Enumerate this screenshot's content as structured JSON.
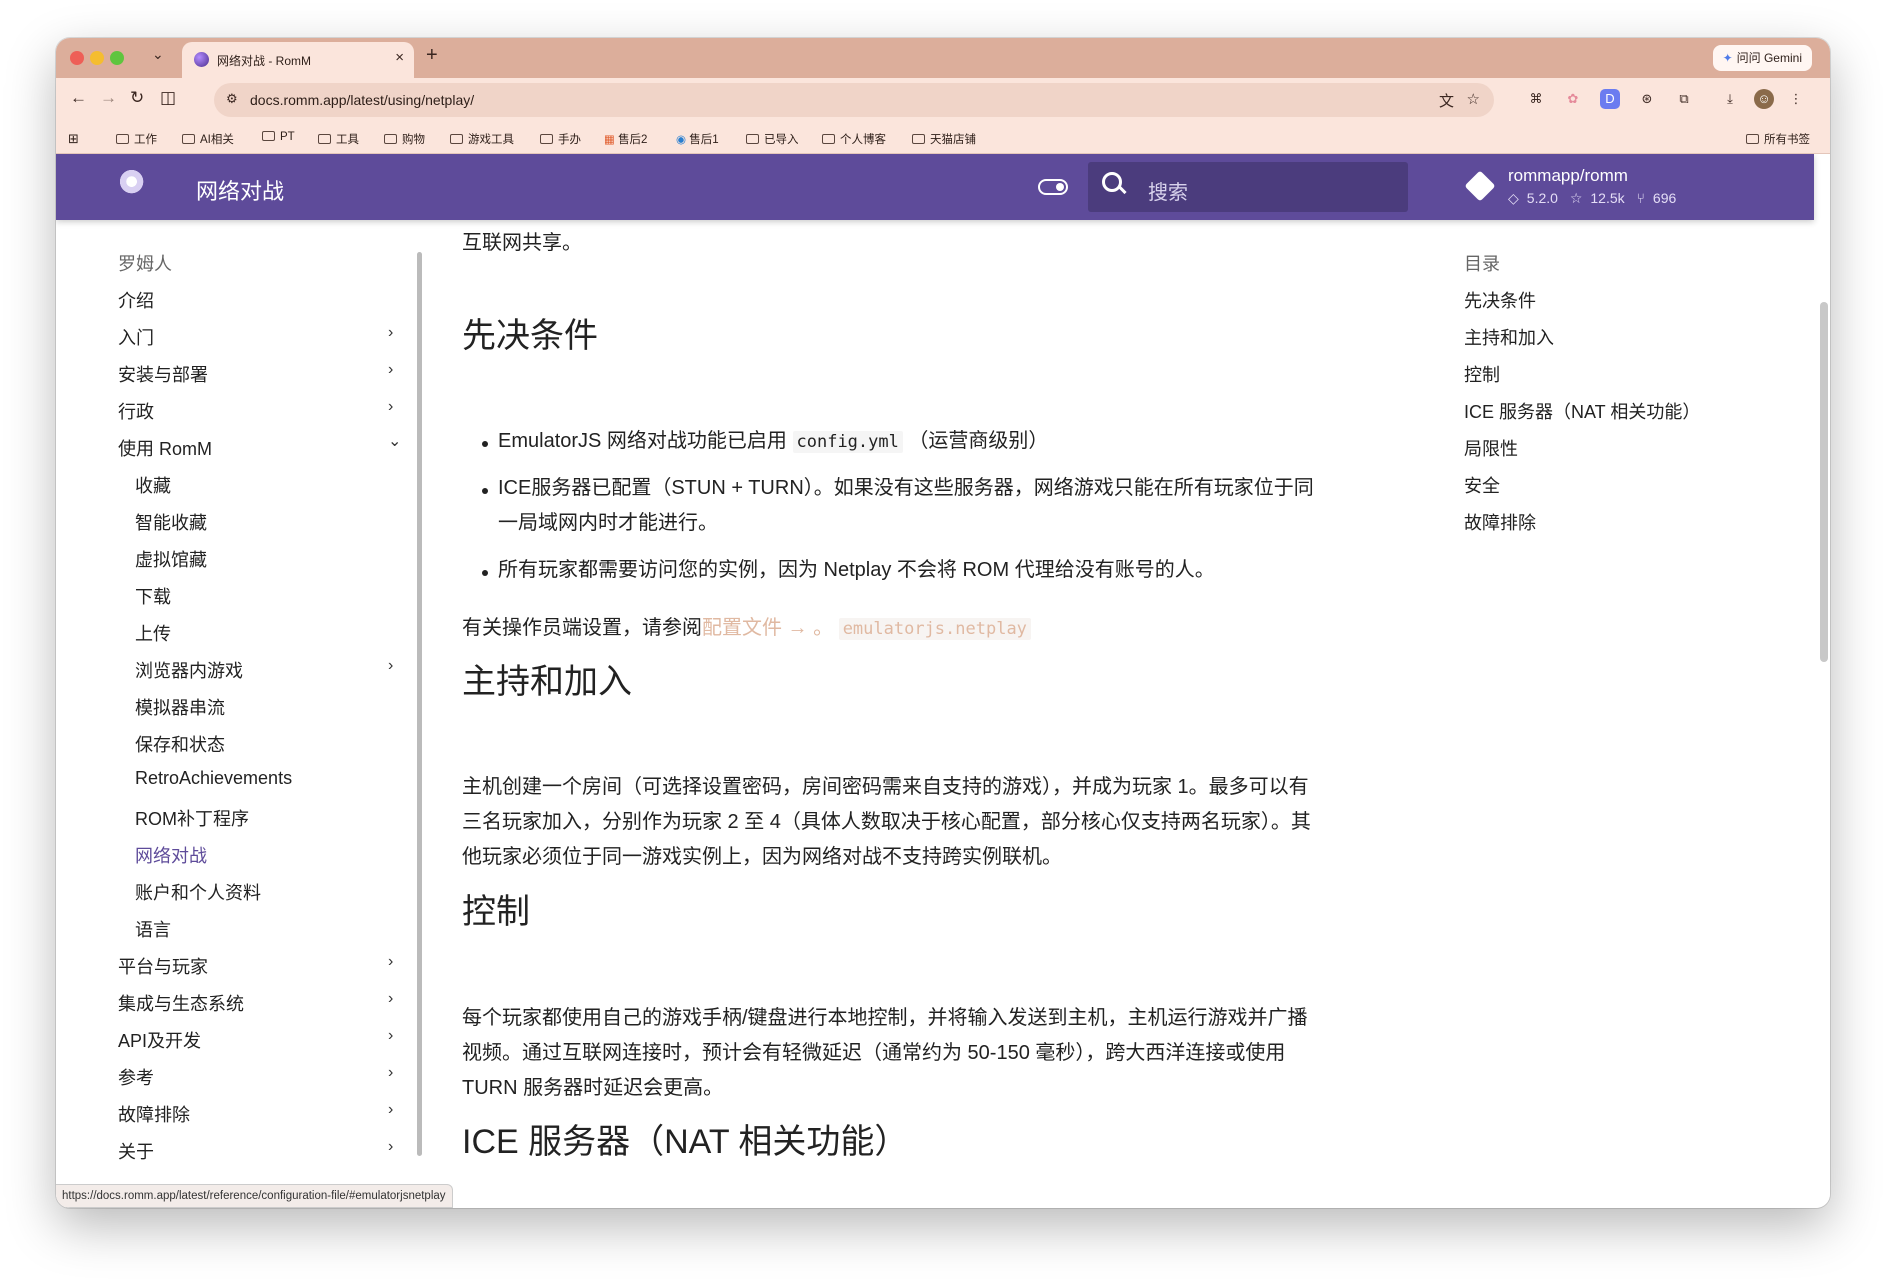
{
  "browser": {
    "tab_title": "网络对战 - RomM",
    "gemini_label": "问问 Gemini",
    "url": "docs.romm.app/latest/using/netplay/",
    "bookmarks": [
      "工作",
      "AI相关",
      "PT",
      "工具",
      "购物",
      "游戏工具",
      "手办",
      "售后2",
      "售后1",
      "已导入",
      "个人博客",
      "天猫店铺"
    ],
    "all_bookmarks": "所有书签",
    "status_url": "https://docs.romm.app/latest/reference/configuration-file/#emulatorjsnetplay"
  },
  "header": {
    "site_title": "网络对战",
    "search_placeholder": "搜索",
    "repo_name": "rommapp/romm",
    "version": "5.2.0",
    "stars": "12.5k",
    "forks": "696"
  },
  "leftnav": {
    "section_title": "罗姆人",
    "items": [
      {
        "label": "介绍",
        "chevron": ""
      },
      {
        "label": "入门",
        "chevron": "›"
      },
      {
        "label": "安装与部署",
        "chevron": "›"
      },
      {
        "label": "行政",
        "chevron": "›"
      },
      {
        "label": "使用 RomM",
        "chevron": "⌄"
      },
      {
        "label": "收藏",
        "chevron": ""
      },
      {
        "label": "智能收藏",
        "chevron": ""
      },
      {
        "label": "虚拟馆藏",
        "chevron": ""
      },
      {
        "label": "下载",
        "chevron": ""
      },
      {
        "label": "上传",
        "chevron": ""
      },
      {
        "label": "浏览器内游戏",
        "chevron": "›"
      },
      {
        "label": "模拟器串流",
        "chevron": ""
      },
      {
        "label": "保存和状态",
        "chevron": ""
      },
      {
        "label": "RetroAchievements",
        "chevron": ""
      },
      {
        "label": "ROM补丁程序",
        "chevron": ""
      },
      {
        "label": "网络对战",
        "chevron": ""
      },
      {
        "label": "账户和个人资料",
        "chevron": ""
      },
      {
        "label": "语言",
        "chevron": ""
      },
      {
        "label": "平台与玩家",
        "chevron": "›"
      },
      {
        "label": "集成与生态系统",
        "chevron": "›"
      },
      {
        "label": "API及开发",
        "chevron": "›"
      },
      {
        "label": "参考",
        "chevron": "›"
      },
      {
        "label": "故障排除",
        "chevron": "›"
      },
      {
        "label": "关于",
        "chevron": "›"
      }
    ]
  },
  "content": {
    "intro_tail": "互联网共享。",
    "prereq_title": "先决条件",
    "prereq_1_a": "EmulatorJS 网络对战功能已启用",
    "prereq_1_code": "config.yml",
    "prereq_1_b": "（运营商级别）",
    "prereq_2_line1": "ICE服务器已配置（STUN + TURN）。如果没有这些服务器，网络游戏只能在所有玩家位于同",
    "prereq_2_line2": "一局域网内时才能进行。",
    "prereq_3": "所有玩家都需要访问您的实例，因为 Netplay 不会将 ROM 代理给没有账号的人。",
    "operator_a": "有关操作员端设置，请参阅",
    "operator_link": "配置文件 →",
    "operator_sep": "。",
    "operator_code": "emulatorjs.netplay",
    "host_title": "主持和加入",
    "host_line1": "主机创建一个房间（可选择设置密码，房间密码需来自支持的游戏），并成为玩家 1。最多可以有",
    "host_line2": "三名玩家加入，分别作为玩家 2 至 4（具体人数取决于核心配置，部分核心仅支持两名玩家）。其",
    "host_line3": "他玩家必须位于同一游戏实例上，因为网络对战不支持跨实例联机。",
    "control_title": "控制",
    "control_line1": "每个玩家都使用自己的游戏手柄/键盘进行本地控制，并将输入发送到主机，主机运行游戏并广播",
    "control_line2": "视频。通过互联网连接时，预计会有轻微延迟（通常约为 50-150 毫秒），跨大西洋连接或使用",
    "control_line3": "TURN 服务器时延迟会更高。",
    "ice_title": "ICE 服务器（NAT 相关功能）"
  },
  "toc": {
    "title": "目录",
    "items": [
      "先决条件",
      "主持和加入",
      "控制",
      "ICE 服务器（NAT 相关功能）",
      "局限性",
      "安全",
      "故障排除"
    ]
  },
  "colors": {
    "header": "#5e4b9a",
    "active_nav": "#5e4b9a",
    "link": "#e0b9a2",
    "tabstrip": "#dcae9b"
  }
}
